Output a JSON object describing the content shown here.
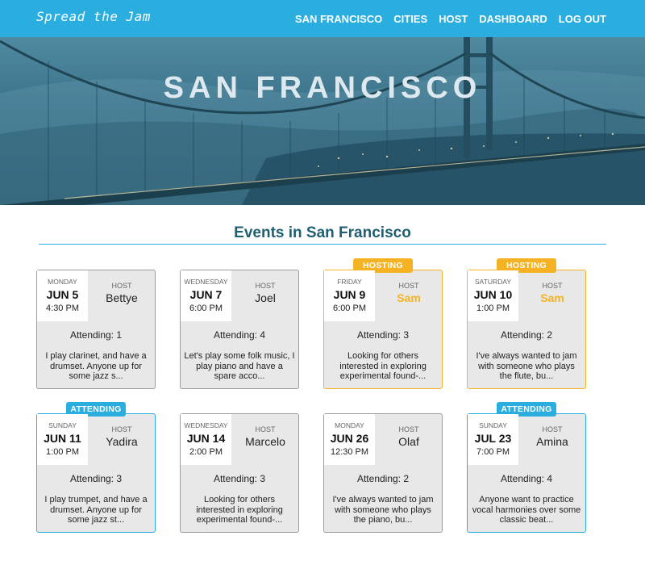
{
  "nav": {
    "logo": "Spread the Jam",
    "links": [
      "SAN FRANCISCO",
      "CITIES",
      "HOST",
      "DASHBOARD",
      "LOG OUT"
    ]
  },
  "hero": {
    "title": "SAN FRANCISCO"
  },
  "section": {
    "title": "Events in San Francisco"
  },
  "colors": {
    "primary": "#29aedf",
    "hosting": "#f5b223",
    "heading": "#1f5f73",
    "card_bg": "#e8e8e8"
  },
  "events": [
    {
      "day": "MONDAY",
      "date": "JUN 5",
      "time": "4:30 PM",
      "host_label": "HOST",
      "host": "Bettye",
      "attending": "Attending: 1",
      "description": "I play clarinet, and have a drumset. Anyone up for some jazz s...",
      "status": ""
    },
    {
      "day": "WEDNESDAY",
      "date": "JUN 7",
      "time": "6:00 PM",
      "host_label": "HOST",
      "host": "Joel",
      "attending": "Attending: 4",
      "description": "Let's play some folk music, I play piano and have a spare acco...",
      "status": ""
    },
    {
      "day": "FRIDAY",
      "date": "JUN 9",
      "time": "6:00 PM",
      "host_label": "HOST",
      "host": "Sam",
      "attending": "Attending: 3",
      "description": "Looking for others interested in exploring experimental found-...",
      "status": "HOSTING"
    },
    {
      "day": "SATURDAY",
      "date": "JUN 10",
      "time": "1:00 PM",
      "host_label": "HOST",
      "host": "Sam",
      "attending": "Attending: 2",
      "description": "I've always wanted to jam with someone who plays the flute, bu...",
      "status": "HOSTING"
    },
    {
      "day": "SUNDAY",
      "date": "JUN 11",
      "time": "1:00 PM",
      "host_label": "HOST",
      "host": "Yadira",
      "attending": "Attending: 3",
      "description": "I play trumpet, and have a drumset. Anyone up for some jazz st...",
      "status": "ATTENDING"
    },
    {
      "day": "WEDNESDAY",
      "date": "JUN 14",
      "time": "2:00 PM",
      "host_label": "HOST",
      "host": "Marcelo",
      "attending": "Attending: 3",
      "description": "Looking for others interested in exploring experimental found-...",
      "status": ""
    },
    {
      "day": "MONDAY",
      "date": "JUN 26",
      "time": "12:30 PM",
      "host_label": "HOST",
      "host": "Olaf",
      "attending": "Attending: 2",
      "description": "I've always wanted to jam with someone who plays the piano, bu...",
      "status": ""
    },
    {
      "day": "SUNDAY",
      "date": "JUL 23",
      "time": "7:00 PM",
      "host_label": "HOST",
      "host": "Amina",
      "attending": "Attending: 4",
      "description": "Anyone want to practice vocal harmonies over some classic beat...",
      "status": "ATTENDING"
    }
  ]
}
